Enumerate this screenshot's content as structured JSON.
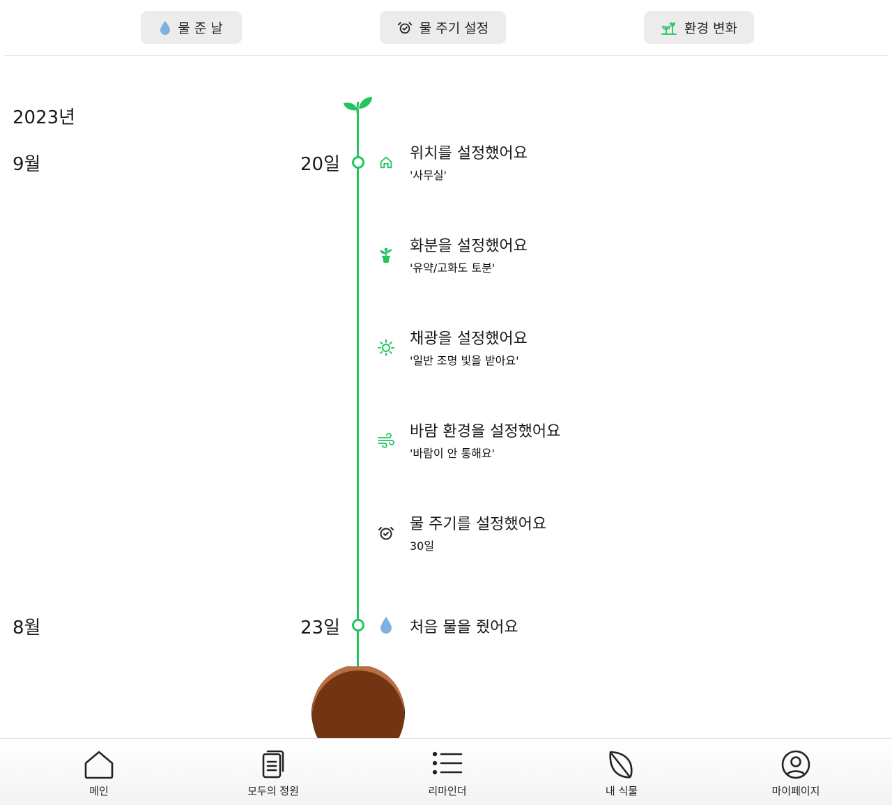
{
  "top_tabs": [
    {
      "label": "물 준 날",
      "icon": "water-drop-icon",
      "color": "#7fb1e0"
    },
    {
      "label": "물 주기 설정",
      "icon": "alarm-clock-icon",
      "color": "#222222"
    },
    {
      "label": "환경 변화",
      "icon": "sprout-icon",
      "color": "#22c55e"
    }
  ],
  "timeline": {
    "year": "2023년",
    "accent_color": "#22c55e",
    "groups": [
      {
        "month": "9월",
        "day": "20일"
      },
      {
        "month": "8월",
        "day": "23일"
      }
    ],
    "events": [
      {
        "title": "위치를 설정했어요",
        "detail": "'사무실'",
        "icon": "home-icon"
      },
      {
        "title": "화분을 설정했어요",
        "detail": "'유약/고화도 토분'",
        "icon": "potted-plant-icon"
      },
      {
        "title": "채광을 설정했어요",
        "detail": "'일반 조명 빛을 받아요'",
        "icon": "sun-icon"
      },
      {
        "title": "바람 환경을 설정했어요",
        "detail": "'바람이 안 통해요'",
        "icon": "wind-icon"
      },
      {
        "title": "물 주기를 설정했어요",
        "detail": "30일",
        "icon": "alarm-clock-icon"
      },
      {
        "title": "처음 물을 줬어요",
        "icon": "water-drop-icon"
      }
    ]
  },
  "bottom_nav": [
    {
      "label": "메인",
      "icon": "home-icon"
    },
    {
      "label": "모두의 정원",
      "icon": "document-icon"
    },
    {
      "label": "리마인더",
      "icon": "list-icon"
    },
    {
      "label": "내 식물",
      "icon": "leaf-icon"
    },
    {
      "label": "마이페이지",
      "icon": "user-circle-icon"
    }
  ]
}
